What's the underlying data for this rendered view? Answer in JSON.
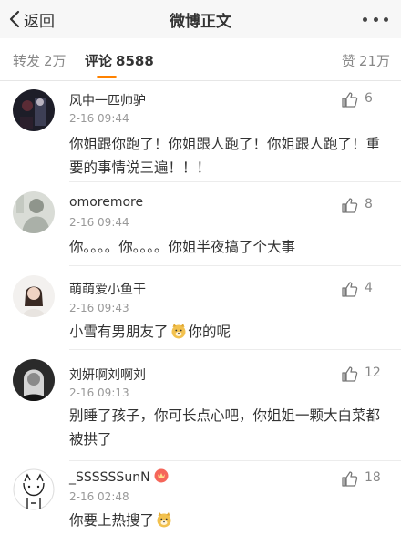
{
  "header": {
    "back_label": "返回",
    "title": "微博正文"
  },
  "tabs": {
    "repost": {
      "label": "转发",
      "count": "2万"
    },
    "comment": {
      "label": "评论",
      "count": "8588"
    },
    "like": {
      "label": "赞",
      "count": "21万"
    }
  },
  "comments": [
    {
      "username": "风中一匹帅驴",
      "time": "2-16 09:44",
      "likes": "6",
      "text": "你姐跟你跑了！你姐跟人跑了！你姐跟人跑了！重要的事情说三遍！！！"
    },
    {
      "username": "omoremore",
      "time": "2-16 09:44",
      "likes": "8",
      "text": "你。。。。你。。。。你姐半夜搞了个大事"
    },
    {
      "username": "萌萌爱小鱼干",
      "time": "2-16 09:43",
      "likes": "4",
      "text_before": "小雪有男朋友了",
      "text_after": "你的呢"
    },
    {
      "username": "刘妍啊刘啊刘",
      "time": "2-16 09:13",
      "likes": "12",
      "text": "别睡了孩子，你可长点心吧，你姐姐一颗大白菜都被拱了"
    },
    {
      "username": "_SSSSSSunN",
      "time": "2-16 02:48",
      "likes": "18",
      "text_before": "你要上热搜了"
    }
  ],
  "colors": {
    "accent": "#ff8200",
    "text": "#333333",
    "meta": "#999999"
  }
}
